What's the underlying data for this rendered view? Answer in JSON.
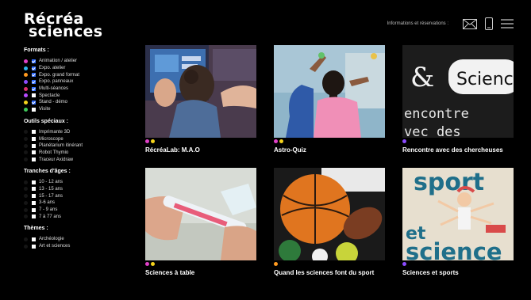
{
  "logo": {
    "line1": "Récréa",
    "line2": "sciences"
  },
  "header": {
    "info_link": "Informations et réservations :"
  },
  "icons": {
    "mail": "envelope-icon",
    "phone": "phone-icon",
    "menu": "hamburger-menu-icon"
  },
  "sidebar": {
    "formats_title": "Formats :",
    "formats": [
      {
        "label": "Animation / atelier",
        "color": "#e040c8",
        "checked": true
      },
      {
        "label": "Expo. atelier",
        "color": "#2fb6f0",
        "checked": true
      },
      {
        "label": "Expo. grand format",
        "color": "#ff9a1f",
        "checked": true
      },
      {
        "label": "Expo. panneaux",
        "color": "#8c4bff",
        "checked": true
      },
      {
        "label": "Multi-séances",
        "color": "#e0306a",
        "checked": true
      },
      {
        "label": "Spectacle",
        "color": "#b84bff",
        "checked": false
      },
      {
        "label": "Stand - démo",
        "color": "#f5d31c",
        "checked": true
      },
      {
        "label": "Visite",
        "color": "#3fc85a",
        "checked": false
      }
    ],
    "tools_title": "Outils spéciaux :",
    "tools": [
      "Imprimante 3D",
      "Microscope",
      "Planétarium itinérant",
      "Robot Thymio",
      "Traceur Axidraw"
    ],
    "ages_title": "Tranches d'âges :",
    "ages": [
      "10 - 12 ans",
      "13 - 15 ans",
      "15 - 17 ans",
      "3-6 ans",
      "7 - 9 ans",
      "7 à 77 ans"
    ],
    "themes_title": "Thèmes :",
    "themes": [
      "Archéologie",
      "Art et sciences"
    ]
  },
  "cards": [
    {
      "title": "RécréaLab: M.A.O",
      "dots": [
        "#e040c8",
        "#f5d31c"
      ]
    },
    {
      "title": "Astro-Quiz",
      "dots": [
        "#e040c8",
        "#f5d31c"
      ]
    },
    {
      "title": "Rencontre avec des chercheuses",
      "dots": [
        "#8c4bff"
      ],
      "image_text_1": "Scienc",
      "image_text_2": "encontre",
      "image_text_3": "vec des"
    },
    {
      "title": "Sciences à table",
      "dots": [
        "#e040c8",
        "#f5d31c"
      ]
    },
    {
      "title": "Quand les sciences font du sport",
      "dots": [
        "#ff9a1f"
      ]
    },
    {
      "title": "Sciences et sports",
      "dots": [
        "#8c4bff"
      ],
      "image_text_1": "sport",
      "image_text_2": "et",
      "image_text_3": "science"
    }
  ]
}
